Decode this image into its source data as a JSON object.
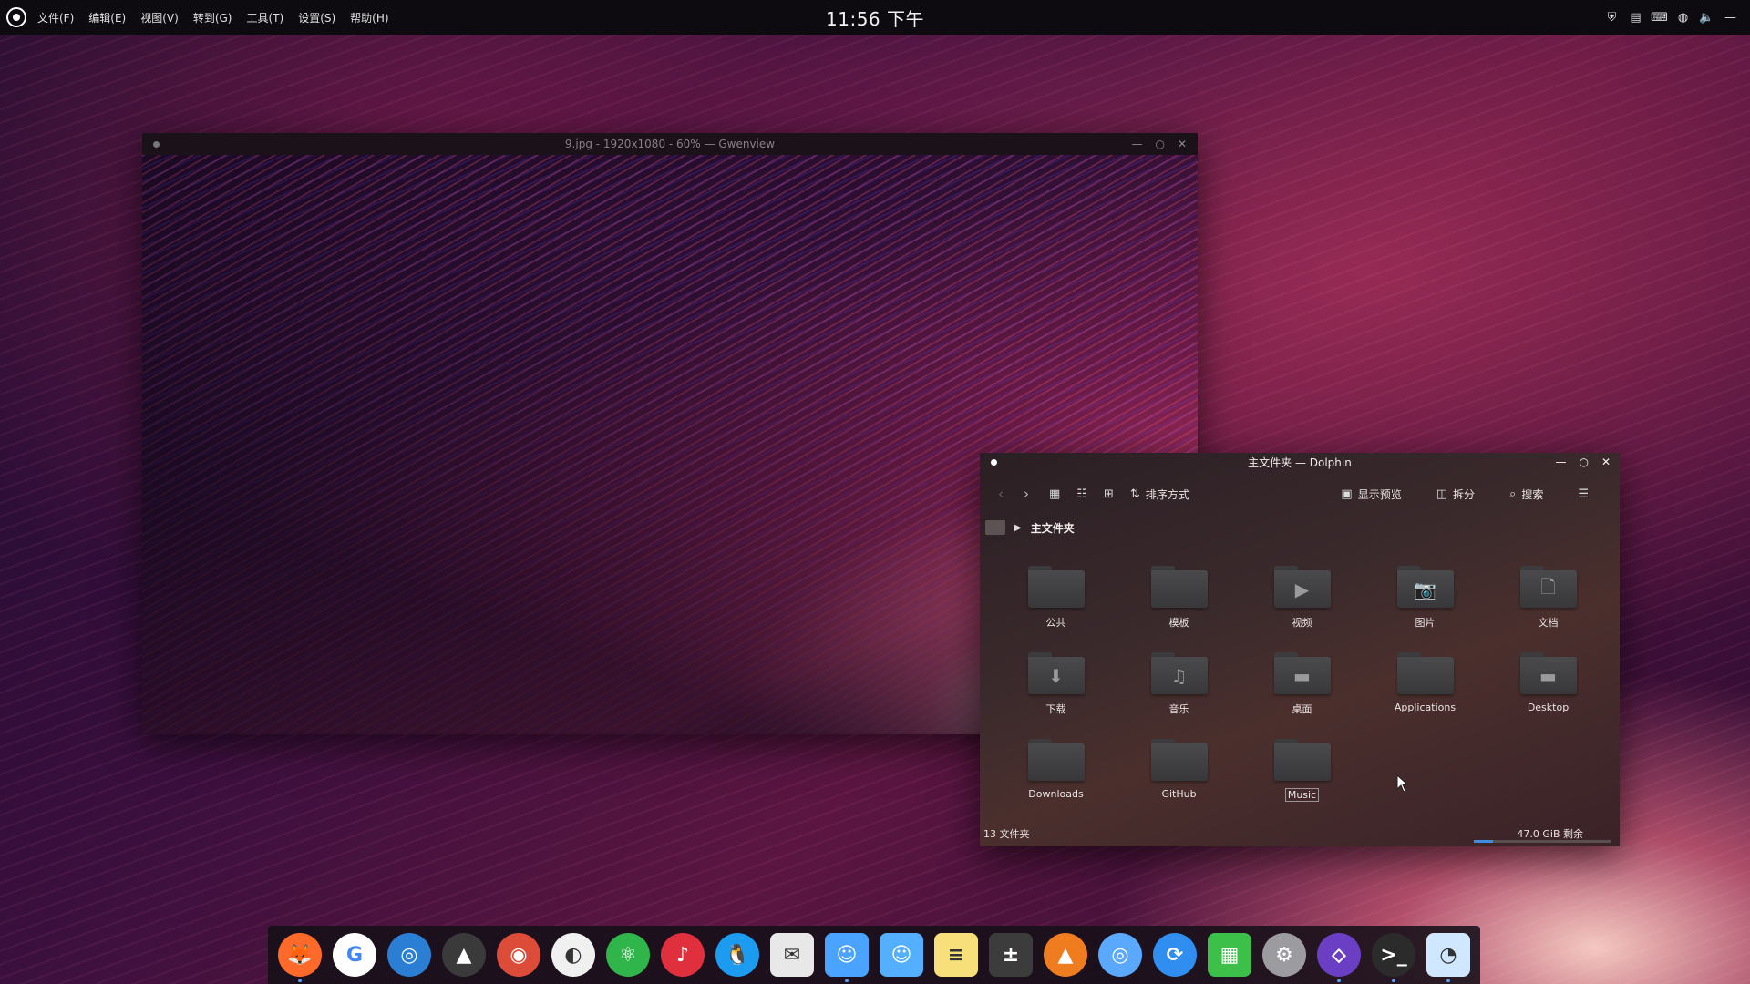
{
  "top_panel": {
    "menu": [
      "文件(F)",
      "编辑(E)",
      "视图(V)",
      "转到(G)",
      "工具(T)",
      "设置(S)",
      "帮助(H)"
    ],
    "clock": "11:56 下午",
    "tray_icons": [
      "shield-icon",
      "clipboard-icon",
      "keyboard-icon",
      "network-icon",
      "volume-icon",
      "minus-icon"
    ]
  },
  "gwenview": {
    "title": "9.jpg - 1920x1080 - 60% — Gwenview"
  },
  "dolphin": {
    "title": "主文件夹 — Dolphin",
    "toolbar": {
      "sort_label": "排序方式",
      "preview_label": "显示预览",
      "split_label": "拆分",
      "search_label": "搜索"
    },
    "breadcrumb": "主文件夹",
    "items": [
      {
        "label": "公共",
        "emblem": ""
      },
      {
        "label": "模板",
        "emblem": ""
      },
      {
        "label": "视频",
        "emblem": "▶"
      },
      {
        "label": "图片",
        "emblem": "📷"
      },
      {
        "label": "文档",
        "emblem": "🗋"
      },
      {
        "label": "下载",
        "emblem": "⬇"
      },
      {
        "label": "音乐",
        "emblem": "♫"
      },
      {
        "label": "桌面",
        "emblem": "▬"
      },
      {
        "label": "Applications",
        "emblem": ""
      },
      {
        "label": "Desktop",
        "emblem": "▬"
      },
      {
        "label": "Downloads",
        "emblem": ""
      },
      {
        "label": "GitHub",
        "emblem": ""
      },
      {
        "label": "Music",
        "emblem": ""
      }
    ],
    "status_left": "13 文件夹",
    "status_right": "47.0 GiB 剩余",
    "space_used_fraction": 0.14
  },
  "dock": {
    "apps": [
      {
        "name": "firefox",
        "glyph": "🦊",
        "color": "#ff6a2b",
        "active": true
      },
      {
        "name": "google",
        "glyph": "G",
        "color": "#ffffff",
        "active": false
      },
      {
        "name": "screenshot",
        "glyph": "◎",
        "color": "#2a7fd4",
        "active": false
      },
      {
        "name": "inkscape",
        "glyph": "▲",
        "color": "#3a3a3a",
        "active": false
      },
      {
        "name": "chrome",
        "glyph": "◉",
        "color": "#dd4b39",
        "active": false
      },
      {
        "name": "github",
        "glyph": "◐",
        "color": "#f0f0f0",
        "active": false
      },
      {
        "name": "atom",
        "glyph": "⚛",
        "color": "#2fb54a",
        "active": false
      },
      {
        "name": "netease-music",
        "glyph": "♪",
        "color": "#e0303e",
        "active": false
      },
      {
        "name": "qq",
        "glyph": "🐧",
        "color": "#1c9cf0",
        "active": false
      },
      {
        "name": "mail",
        "glyph": "✉",
        "color": "#e8e8e8",
        "active": false
      },
      {
        "name": "finder",
        "glyph": "☺",
        "color": "#4aa3ff",
        "active": true
      },
      {
        "name": "files",
        "glyph": "☺",
        "color": "#54b0ff",
        "active": false
      },
      {
        "name": "notes",
        "glyph": "≡",
        "color": "#f7e07a",
        "active": false
      },
      {
        "name": "calculator",
        "glyph": "±",
        "color": "#3c3c3c",
        "active": false
      },
      {
        "name": "vlc",
        "glyph": "▲",
        "color": "#f07c20",
        "active": false
      },
      {
        "name": "browser",
        "glyph": "◎",
        "color": "#5aa9ff",
        "active": false
      },
      {
        "name": "share",
        "glyph": "⟳",
        "color": "#2f8ef0",
        "active": false
      },
      {
        "name": "image-viewer",
        "glyph": "▦",
        "color": "#3cc04a",
        "active": false
      },
      {
        "name": "settings",
        "glyph": "⚙",
        "color": "#9c9ca0",
        "active": false
      },
      {
        "name": "kdeconnect",
        "glyph": "⬦",
        "color": "#6b3fc4",
        "active": true
      },
      {
        "name": "terminal",
        "glyph": ">_",
        "color": "#2b2b2b",
        "active": true
      },
      {
        "name": "photos",
        "glyph": "◔",
        "color": "#cfe8ff",
        "active": true
      }
    ]
  }
}
